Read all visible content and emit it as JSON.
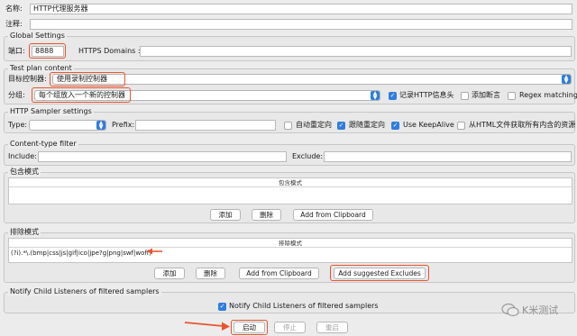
{
  "header": {
    "name_label": "名称:",
    "name_value": "HTTP代理服务器",
    "comment_label": "注释:"
  },
  "global_settings": {
    "title": "Global Settings",
    "port_label": "端口:",
    "port_value": "8888",
    "https_label": "HTTPS Domains :",
    "https_value": ""
  },
  "test_plan": {
    "title": "Test plan content",
    "target_label": "目标控制器:",
    "target_value": "使用录制控制器",
    "group_label": "分组:",
    "group_value": "每个组放入一个新的控制器",
    "record_headers": {
      "label": "记录HTTP信息头",
      "checked": true
    },
    "add_assertions": {
      "label": "添加断言",
      "checked": false
    },
    "regex_matching": {
      "label": "Regex matching",
      "checked": false
    }
  },
  "sampler_settings": {
    "title": "HTTP Sampler settings",
    "type_label": "Type:",
    "type_value": "",
    "prefix_label": "Prefix:",
    "prefix_value": "",
    "auto_redirect": {
      "label": "自动重定向",
      "checked": false
    },
    "follow_redirect": {
      "label": "跟随重定向",
      "checked": true
    },
    "keepalive": {
      "label": "Use KeepAlive",
      "checked": true
    },
    "retrieve_resources": {
      "label": "从HTML文件获取所有内含的资源",
      "checked": false
    }
  },
  "content_filter": {
    "title": "Content-type filter",
    "include_label": "Include:",
    "include_value": "",
    "exclude_label": "Exclude:",
    "exclude_value": ""
  },
  "include_patterns": {
    "title": "包含模式",
    "column": "包含模式",
    "add": "添加",
    "delete": "删除",
    "clipboard": "Add from Clipboard"
  },
  "exclude_patterns": {
    "title": "排除模式",
    "column": "排除模式",
    "rows": [
      "(?i).*\\.(bmp|css|js|gif|ico|jpe?g|png|swf|woff)"
    ],
    "add": "添加",
    "delete": "删除",
    "clipboard": "Add from Clipboard",
    "suggested": "Add suggested Excludes"
  },
  "notify": {
    "title": "Notify Child Listeners of filtered samplers",
    "checkbox": {
      "label": "Notify Child Listeners of filtered samplers",
      "checked": true
    }
  },
  "footer": {
    "start": "启动",
    "stop": "停止",
    "restart": "重启"
  },
  "watermark": "K米测试",
  "colors": {
    "highlight": "#e8552d",
    "accent": "#2e7de0"
  }
}
